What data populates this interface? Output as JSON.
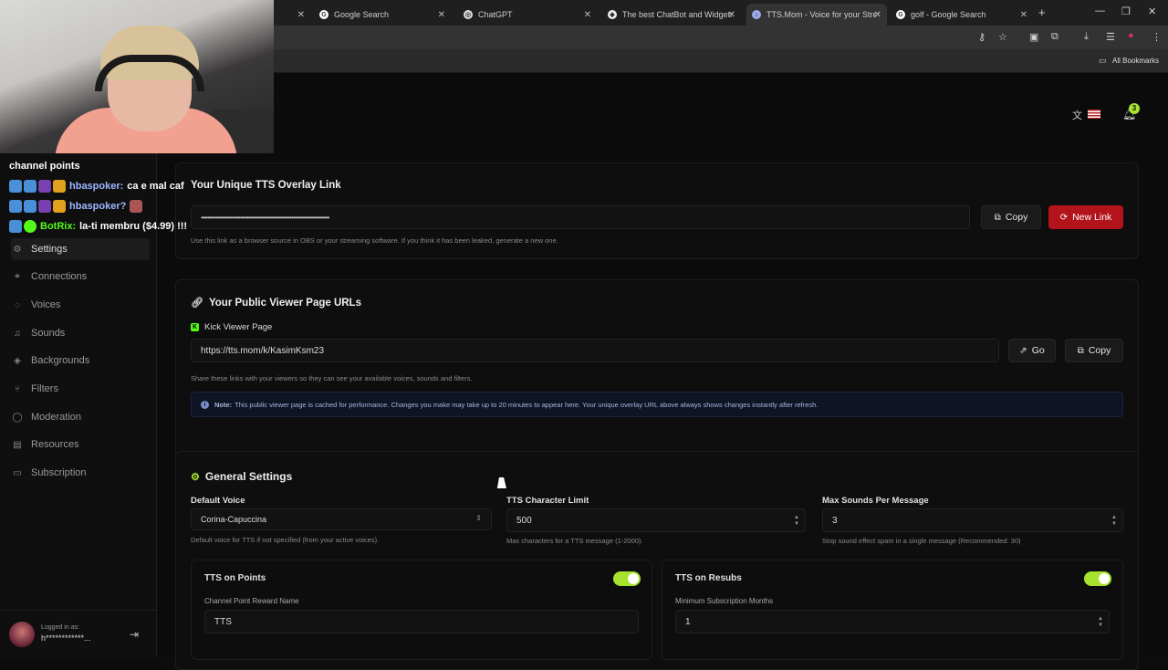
{
  "browser": {
    "tabs": [
      {
        "title": "Google Search",
        "icon": "google-icon"
      },
      {
        "title": "ChatGPT",
        "icon": "chatgpt-icon"
      },
      {
        "title": "The best ChatBot and Widgets",
        "icon": "botrix-icon"
      },
      {
        "title": "TTS.Mom - Voice for your Strea",
        "icon": "tts-mom-icon"
      },
      {
        "title": "golf - Google Search",
        "icon": "google-icon"
      }
    ],
    "bookmarks_label": "All Bookmarks"
  },
  "chat": {
    "lines": [
      {
        "text": "channel points"
      },
      {
        "user": "hbaspoker:",
        "message": "ca e mal caf"
      },
      {
        "user": "hbaspoker?",
        "message": ""
      },
      {
        "user": "BotRix:",
        "message": "la-ti membru ($4.99) !!!"
      }
    ]
  },
  "sidebar": {
    "items": [
      {
        "label": "Settings",
        "icon": "gear-icon"
      },
      {
        "label": "Connections",
        "icon": "link-icon"
      },
      {
        "label": "Voices",
        "icon": "mic-icon"
      },
      {
        "label": "Sounds",
        "icon": "music-icon"
      },
      {
        "label": "Backgrounds",
        "icon": "image-icon"
      },
      {
        "label": "Filters",
        "icon": "filter-icon"
      },
      {
        "label": "Moderation",
        "icon": "shield-icon"
      },
      {
        "label": "Resources",
        "icon": "book-icon"
      },
      {
        "label": "Subscription",
        "icon": "card-icon"
      }
    ],
    "user": {
      "logged_in_label": "Logged in as:",
      "username": "h************..."
    }
  },
  "header": {
    "notification_count": "3",
    "locale_flag": "us-flag-icon"
  },
  "overlay_card": {
    "title": "Your Unique TTS Overlay Link",
    "link_masked": "••••••••••••••••••••••••••••••••••••••••••••••••••••••••••••••••••••••••••••••",
    "copy_label": "Copy",
    "new_link_label": "New Link",
    "help": "Use this link as a browser source in OBS or your streaming software. If you think it has been leaked, generate a new one."
  },
  "viewer_card": {
    "title": "Your Public Viewer Page URLs",
    "kick_label": "Kick Viewer Page",
    "kick_url": "https://tts.mom/k/KasimKsm23",
    "go_label": "Go",
    "copy_label": "Copy",
    "help": "Share these links with your viewers so they can see your available voices, sounds and filters.",
    "note_label": "Note:",
    "note_text": "This public viewer page is cached for performance. Changes you make may take up to 20 minutes to appear here. Your unique overlay URL above always shows changes instantly after refresh."
  },
  "general": {
    "title": "General Settings",
    "default_voice_label": "Default Voice",
    "default_voice_value": "Corina-Capuccina",
    "default_voice_help": "Default voice for TTS if not specified (from your active voices).",
    "char_limit_label": "TTS Character Limit",
    "char_limit_value": "500",
    "char_limit_help": "Max characters for a TTS message (1-2000).",
    "max_sounds_label": "Max Sounds Per Message",
    "max_sounds_value": "3",
    "max_sounds_help": "Stop sound effect spam in a single message (Recommended: 30)",
    "points": {
      "title": "TTS on Points",
      "enabled": true,
      "reward_label": "Channel Point Reward Name",
      "reward_value": "TTS"
    },
    "resubs": {
      "title": "TTS on Resubs",
      "enabled": true,
      "min_months_label": "Minimum Subscription Months",
      "min_months_value": "1"
    }
  },
  "colors": {
    "accent_green": "#a6e22e",
    "danger_red": "#b3131b",
    "kick_green": "#53fc18"
  }
}
